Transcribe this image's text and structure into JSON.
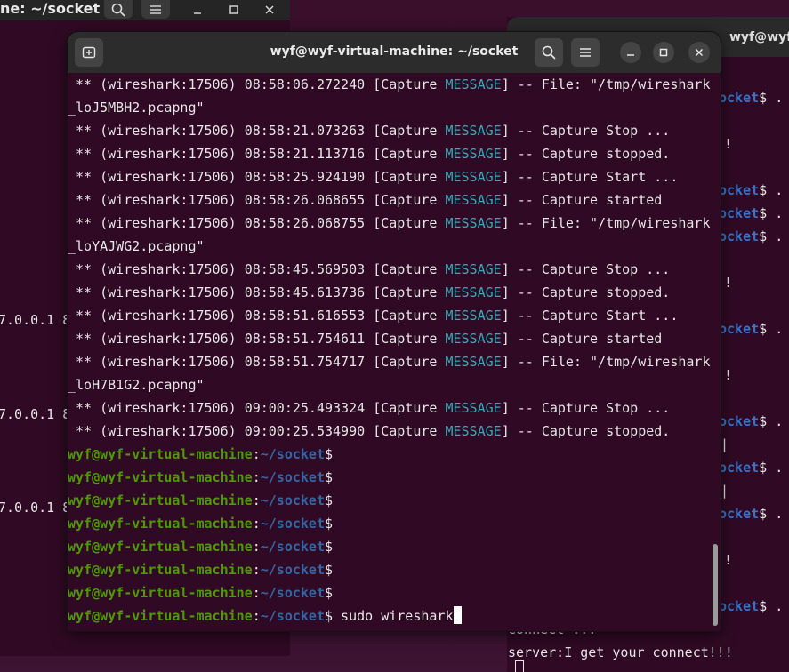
{
  "left_window": {
    "title": "ne: ~/socket",
    "lines": [
      "7.0.0.1 8",
      "7.0.0.1 8",
      "7.0.0.1 8"
    ]
  },
  "right_window": {
    "title": "wyf@wyf-virtual-machine: ~/socket",
    "prompt_path": "ocket",
    "prompt_suffix": "$ .",
    "bang": "!",
    "pipe": "|",
    "connect_line": "connect ...",
    "server_line": "server:I get your connect!!!"
  },
  "main_window": {
    "title": "wyf@wyf-virtual-machine: ~/socket",
    "prompt_user": "wyf@wyf-virtual-machine",
    "prompt_sep": ":",
    "prompt_path": "~/socket",
    "prompt_symbol": "$",
    "command": " sudo wireshark",
    "log_prefix": " ** (wireshark:17506) ",
    "capture_open": "[Capture ",
    "message_tag": "MESSAGE",
    "capture_close": "] -- ",
    "log_lines": [
      {
        "time": "08:58:06.272240",
        "text": "File: \"/tmp/wireshark"
      },
      {
        "cont": "_loJ5MBH2.pcapng\""
      },
      {
        "time": "08:58:21.073263",
        "text": "Capture Stop ..."
      },
      {
        "time": "08:58:21.113716",
        "text": "Capture stopped."
      },
      {
        "time": "08:58:25.924190",
        "text": "Capture Start ..."
      },
      {
        "time": "08:58:26.068655",
        "text": "Capture started"
      },
      {
        "time": "08:58:26.068755",
        "text": "File: \"/tmp/wireshark"
      },
      {
        "cont": "_loYAJWG2.pcapng\""
      },
      {
        "time": "08:58:45.569503",
        "text": "Capture Stop ..."
      },
      {
        "time": "08:58:45.613736",
        "text": "Capture stopped."
      },
      {
        "time": "08:58:51.616553",
        "text": "Capture Start ..."
      },
      {
        "time": "08:58:51.754611",
        "text": "Capture started"
      },
      {
        "time": "08:58:51.754717",
        "text": "File: \"/tmp/wireshark"
      },
      {
        "cont": "_loH7B1G2.pcapng\""
      },
      {
        "time": "09:00:25.493324",
        "text": "Capture Stop ..."
      },
      {
        "time": "09:00:25.534990",
        "text": "Capture stopped."
      }
    ],
    "empty_prompts": 7
  },
  "icons": {
    "new_tab": "new-tab-icon",
    "search": "search-icon",
    "menu": "hamburger-menu-icon",
    "minimize": "minimize-icon",
    "maximize": "maximize-icon",
    "close": "close-icon"
  },
  "colors": {
    "terminal_bg": "#300a24",
    "message": "#3aa8b5",
    "prompt_user": "#4e9a06",
    "prompt_path": "#3465a4"
  }
}
